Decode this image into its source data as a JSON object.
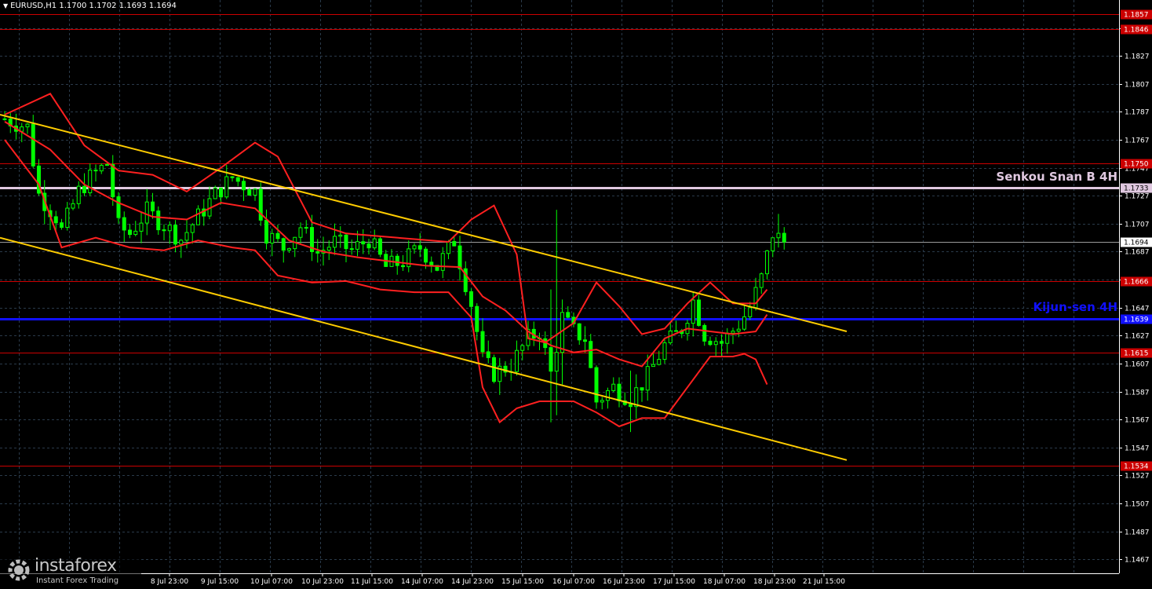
{
  "header": {
    "symbol_label": "EURUSD,H1",
    "ohlc": "1.1700 1.1702 1.1693 1.1694"
  },
  "watermark": {
    "name": "instaforex",
    "tagline": "Instant Forex Trading"
  },
  "annotations": {
    "senkou_label": "Senkou Snan B 4H",
    "kijun_label": "Kijun-sen 4H"
  },
  "colors": {
    "background": "#000000",
    "grid": "#2a3a4a",
    "candle": "#00ff00",
    "bands": "#ff2020",
    "channel": "#ffcc00",
    "kijun": "#1010ff",
    "senkou": "#e0c8e0",
    "levels": "#cc0000",
    "price_line": "#9a9a9a",
    "axis_text": "#ffffff"
  },
  "chart_data": {
    "type": "candlestick",
    "timeframe": "H1",
    "ylim": [
      1.1457,
      1.1867
    ],
    "y_ticks": [
      "1.1467",
      "1.1487",
      "1.1507",
      "1.1527",
      "1.1547",
      "1.1567",
      "1.1587",
      "1.1607",
      "1.1627",
      "1.1647",
      "1.1667",
      "1.1687",
      "1.1707",
      "1.1727",
      "1.1747",
      "1.1767",
      "1.1787",
      "1.1807",
      "1.1827",
      "1.1847"
    ],
    "x_ticks": [
      "8 Jul 23:00",
      "9 Jul 15:00",
      "10 Jul 07:00",
      "10 Jul 23:00",
      "11 Jul 15:00",
      "14 Jul 07:00",
      "14 Jul 23:00",
      "15 Jul 15:00",
      "16 Jul 07:00",
      "16 Jul 23:00",
      "17 Jul 15:00",
      "18 Jul 07:00",
      "18 Jul 23:00",
      "21 Jul 15:00"
    ],
    "last_price": "1.1694",
    "horizontal_levels": [
      {
        "label": "1.1857",
        "value": 1.1857,
        "kind": "resistance"
      },
      {
        "label": "1.1846",
        "value": 1.1846,
        "kind": "resistance"
      },
      {
        "label": "1.1750",
        "value": 1.175,
        "kind": "resistance"
      },
      {
        "label": "1.1733",
        "value": 1.1733,
        "kind": "senkou"
      },
      {
        "label": "1.1666",
        "value": 1.1666,
        "kind": "resistance"
      },
      {
        "label": "1.1639",
        "value": 1.1639,
        "kind": "kijun"
      },
      {
        "label": "1.1615",
        "value": 1.1615,
        "kind": "support"
      },
      {
        "label": "1.1534",
        "value": 1.1534,
        "kind": "support"
      }
    ],
    "channel": {
      "upper": [
        [
          0,
          1.1785
        ],
        [
          148,
          1.163
        ]
      ],
      "lower": [
        [
          0,
          1.1697
        ],
        [
          148,
          1.1538
        ]
      ]
    },
    "close_path": [
      [
        0,
        1.1782
      ],
      [
        4,
        1.1776
      ],
      [
        6,
        1.1728
      ],
      [
        9,
        1.1712
      ],
      [
        10,
        1.1702
      ],
      [
        13,
        1.173
      ],
      [
        15,
        1.174
      ],
      [
        18,
        1.175
      ],
      [
        20,
        1.1705
      ],
      [
        22,
        1.17
      ],
      [
        25,
        1.1716
      ],
      [
        28,
        1.1706
      ],
      [
        31,
        1.1696
      ],
      [
        34,
        1.1712
      ],
      [
        37,
        1.1728
      ],
      [
        40,
        1.174
      ],
      [
        44,
        1.173
      ],
      [
        46,
        1.17
      ],
      [
        49,
        1.169
      ],
      [
        52,
        1.1705
      ],
      [
        55,
        1.1686
      ],
      [
        58,
        1.1694
      ],
      [
        61,
        1.1688
      ],
      [
        64,
        1.1696
      ],
      [
        67,
        1.1676
      ],
      [
        70,
        1.168
      ],
      [
        73,
        1.169
      ],
      [
        76,
        1.1676
      ],
      [
        79,
        1.1695
      ],
      [
        82,
        1.165
      ],
      [
        84,
        1.161
      ],
      [
        86,
        1.16
      ],
      [
        89,
        1.1606
      ],
      [
        92,
        1.1625
      ],
      [
        94,
        1.163
      ],
      [
        96,
        1.16
      ],
      [
        98,
        1.164
      ],
      [
        100,
        1.163
      ],
      [
        102,
        1.1625
      ],
      [
        104,
        1.158
      ],
      [
        107,
        1.159
      ],
      [
        110,
        1.1582
      ],
      [
        113,
        1.1598
      ],
      [
        116,
        1.162
      ],
      [
        119,
        1.1632
      ],
      [
        121,
        1.1652
      ],
      [
        123,
        1.1628
      ],
      [
        126,
        1.1622
      ],
      [
        129,
        1.1635
      ],
      [
        131,
        1.1647
      ],
      [
        133,
        1.1668
      ],
      [
        135,
        1.17
      ],
      [
        137,
        1.1694
      ]
    ],
    "bands": {
      "upper": [
        [
          0,
          1.1785
        ],
        [
          8,
          1.18
        ],
        [
          14,
          1.1763
        ],
        [
          20,
          1.1745
        ],
        [
          26,
          1.1742
        ],
        [
          32,
          1.173
        ],
        [
          38,
          1.1747
        ],
        [
          44,
          1.1765
        ],
        [
          48,
          1.1755
        ],
        [
          54,
          1.1708
        ],
        [
          60,
          1.17
        ],
        [
          66,
          1.1698
        ],
        [
          72,
          1.1696
        ],
        [
          78,
          1.1694
        ],
        [
          82,
          1.171
        ],
        [
          86,
          1.172
        ],
        [
          90,
          1.1685
        ],
        [
          92,
          1.1625
        ],
        [
          95,
          1.1622
        ],
        [
          100,
          1.1636
        ],
        [
          104,
          1.1665
        ],
        [
          108,
          1.1648
        ],
        [
          112,
          1.1628
        ],
        [
          116,
          1.1632
        ],
        [
          120,
          1.165
        ],
        [
          124,
          1.1665
        ],
        [
          128,
          1.165
        ],
        [
          132,
          1.165
        ],
        [
          134,
          1.166
        ]
      ],
      "middle": [
        [
          0,
          1.178
        ],
        [
          8,
          1.176
        ],
        [
          14,
          1.1735
        ],
        [
          20,
          1.1722
        ],
        [
          26,
          1.1712
        ],
        [
          32,
          1.171
        ],
        [
          38,
          1.1722
        ],
        [
          44,
          1.1718
        ],
        [
          50,
          1.1695
        ],
        [
          56,
          1.1687
        ],
        [
          62,
          1.1683
        ],
        [
          68,
          1.168
        ],
        [
          74,
          1.1677
        ],
        [
          80,
          1.1676
        ],
        [
          84,
          1.1655
        ],
        [
          88,
          1.1645
        ],
        [
          92,
          1.163
        ],
        [
          96,
          1.162
        ],
        [
          100,
          1.1615
        ],
        [
          104,
          1.1617
        ],
        [
          108,
          1.161
        ],
        [
          112,
          1.1605
        ],
        [
          116,
          1.1625
        ],
        [
          120,
          1.1632
        ],
        [
          124,
          1.163
        ],
        [
          128,
          1.1628
        ],
        [
          132,
          1.163
        ],
        [
          134,
          1.1642
        ]
      ],
      "lower": [
        [
          0,
          1.1767
        ],
        [
          6,
          1.1735
        ],
        [
          10,
          1.169
        ],
        [
          16,
          1.1697
        ],
        [
          22,
          1.169
        ],
        [
          28,
          1.1688
        ],
        [
          34,
          1.1695
        ],
        [
          40,
          1.169
        ],
        [
          44,
          1.1688
        ],
        [
          48,
          1.167
        ],
        [
          54,
          1.1665
        ],
        [
          60,
          1.1666
        ],
        [
          66,
          1.166
        ],
        [
          72,
          1.1658
        ],
        [
          78,
          1.1658
        ],
        [
          82,
          1.164
        ],
        [
          84,
          1.159
        ],
        [
          87,
          1.1565
        ],
        [
          90,
          1.1575
        ],
        [
          94,
          1.158
        ],
        [
          100,
          1.158
        ],
        [
          104,
          1.1572
        ],
        [
          108,
          1.1562
        ],
        [
          112,
          1.1568
        ],
        [
          116,
          1.1568
        ],
        [
          120,
          1.159
        ],
        [
          124,
          1.1612
        ],
        [
          128,
          1.1612
        ],
        [
          130,
          1.1614
        ],
        [
          132,
          1.161
        ],
        [
          134,
          1.1592
        ]
      ]
    },
    "volatile_bars": [
      {
        "i": 96,
        "high": 1.166,
        "low": 1.1565
      },
      {
        "i": 97,
        "high": 1.1717,
        "low": 1.157
      },
      {
        "i": 98,
        "high": 1.1648,
        "low": 1.1592
      },
      {
        "i": 110,
        "high": 1.1602,
        "low": 1.1558
      },
      {
        "i": 136,
        "high": 1.1714,
        "low": 1.169
      }
    ]
  }
}
